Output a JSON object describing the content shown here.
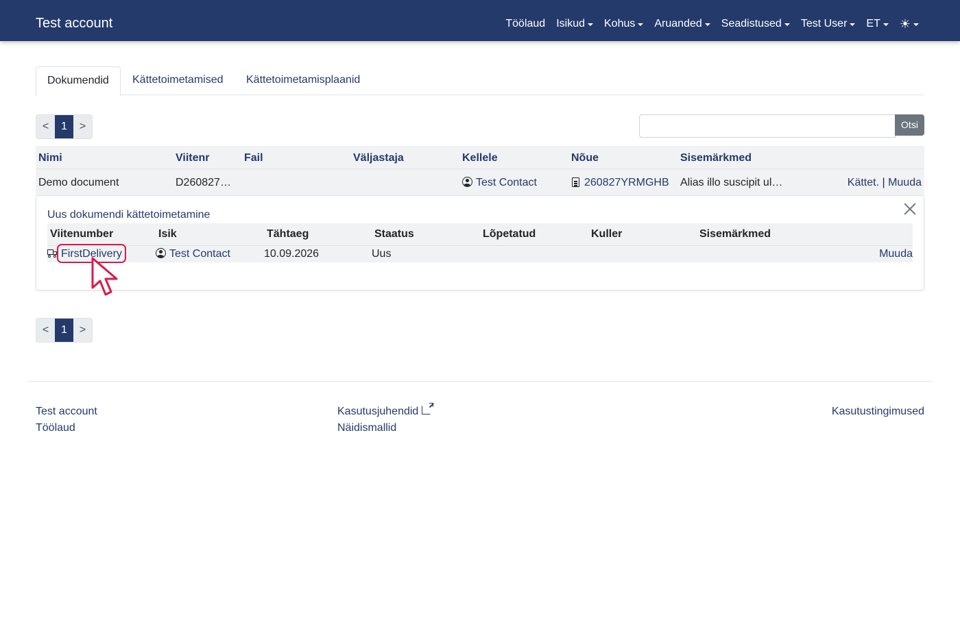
{
  "navbar": {
    "brand": "Test account",
    "items": [
      {
        "label": "Töölaud",
        "dropdown": false
      },
      {
        "label": "Isikud",
        "dropdown": true
      },
      {
        "label": "Kohus",
        "dropdown": true
      },
      {
        "label": "Aruanded",
        "dropdown": true
      },
      {
        "label": "Seadistused",
        "dropdown": true
      },
      {
        "label": "Test User",
        "dropdown": true
      },
      {
        "label": "ET",
        "dropdown": true
      },
      {
        "label": "☀",
        "dropdown": true,
        "icon": "sun-icon"
      }
    ]
  },
  "tabs": [
    {
      "label": "Dokumendid",
      "active": true
    },
    {
      "label": "Kättetoimetamised",
      "active": false
    },
    {
      "label": "Kättetoimetamisplaanid",
      "active": false
    }
  ],
  "pagination": {
    "prev": "<",
    "current": "1",
    "next": ">"
  },
  "search": {
    "value": "",
    "placeholder": "",
    "button_label": "Otsi"
  },
  "documents_table": {
    "headers": [
      "Nimi",
      "Viitenr",
      "Fail",
      "Väljastaja",
      "Kellele",
      "Nõue",
      "Sisemärkmed"
    ],
    "rows": [
      {
        "name": "Demo document",
        "reference": "D260827…",
        "file": "",
        "issuer": "",
        "recipient": "Test Contact",
        "claim": "260827YRMGHB",
        "notes": "Alias illo suscipit ul…",
        "action_deliver": "Kättet.",
        "action_separator": "|",
        "action_edit": "Muuda"
      }
    ]
  },
  "delivery_card": {
    "title": "Uus dokumendi kättetoimetamine",
    "headers": [
      "Viitenumber",
      "Isik",
      "Tähtaeg",
      "Staatus",
      "Lõpetatud",
      "Kuller",
      "Sisemärkmed"
    ],
    "rows": [
      {
        "reference": "FirstDelivery",
        "person": "Test Contact",
        "deadline": "10.09.2026",
        "status": "Uus",
        "completed": "",
        "courier": "",
        "notes": "",
        "action_edit": "Muuda"
      }
    ]
  },
  "footer": {
    "col1": [
      "Test account",
      "Töölaud"
    ],
    "col2": [
      "Kasutusjuhendid",
      "Näidismallid"
    ],
    "col3": [
      "Kasutustingimused"
    ]
  },
  "colors": {
    "navbar_bg": "#243a6b",
    "link": "#243a6b",
    "highlight": "#d81b4a",
    "table_bg": "#f1f2f4"
  }
}
